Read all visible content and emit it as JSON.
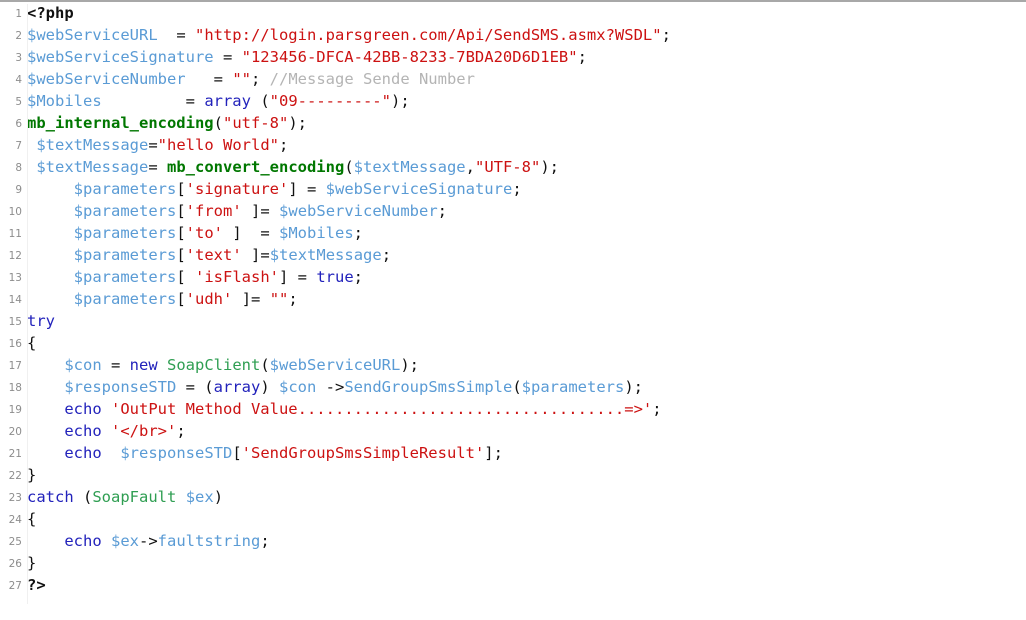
{
  "editor": {
    "language": "php",
    "total_lines": 27,
    "background": "#ffffff",
    "gutter_color": "#8d8d8d",
    "top_rule_color": "#a8a8a8"
  },
  "palette": {
    "variable": "#5a9bd5",
    "string": "#cc1111",
    "keyword": "#2222bb",
    "function": "#007700",
    "class": "#2f9e52",
    "comment": "#b4b4b4",
    "punctuation": "#111111"
  },
  "lines": [
    {
      "n": "1",
      "tokens": [
        {
          "t": "php",
          "v": "<?php"
        }
      ]
    },
    {
      "n": "2",
      "tokens": [
        {
          "t": "var",
          "v": "$webServiceURL"
        },
        {
          "t": "plain",
          "v": "  = "
        },
        {
          "t": "str",
          "v": "\"http://login.parsgreen.com/Api/SendSMS.asmx?WSDL\""
        },
        {
          "t": "punc",
          "v": ";"
        }
      ]
    },
    {
      "n": "3",
      "tokens": [
        {
          "t": "var",
          "v": "$webServiceSignature"
        },
        {
          "t": "plain",
          "v": " = "
        },
        {
          "t": "str",
          "v": "\"123456-DFCA-42BB-8233-7BDA20D6D1EB\""
        },
        {
          "t": "punc",
          "v": ";"
        }
      ]
    },
    {
      "n": "4",
      "tokens": [
        {
          "t": "var",
          "v": "$webServiceNumber"
        },
        {
          "t": "plain",
          "v": "   = "
        },
        {
          "t": "str",
          "v": "\"\""
        },
        {
          "t": "punc",
          "v": ";"
        },
        {
          "t": "plain",
          "v": " "
        },
        {
          "t": "com",
          "v": "//Message Sende Number"
        }
      ]
    },
    {
      "n": "5",
      "tokens": [
        {
          "t": "var",
          "v": "$Mobiles"
        },
        {
          "t": "plain",
          "v": "         = "
        },
        {
          "t": "kw",
          "v": "array"
        },
        {
          "t": "plain",
          "v": " ("
        },
        {
          "t": "str",
          "v": "\"09---------\""
        },
        {
          "t": "punc",
          "v": ");"
        }
      ]
    },
    {
      "n": "6",
      "tokens": [
        {
          "t": "fn",
          "v": "mb_internal_encoding"
        },
        {
          "t": "punc",
          "v": "("
        },
        {
          "t": "str",
          "v": "\"utf-8\""
        },
        {
          "t": "punc",
          "v": ");"
        }
      ]
    },
    {
      "n": "7",
      "tokens": [
        {
          "t": "plain",
          "v": " "
        },
        {
          "t": "var",
          "v": "$textMessage"
        },
        {
          "t": "plain",
          "v": "="
        },
        {
          "t": "str",
          "v": "\"hello World\""
        },
        {
          "t": "punc",
          "v": ";"
        }
      ]
    },
    {
      "n": "8",
      "tokens": [
        {
          "t": "plain",
          "v": " "
        },
        {
          "t": "var",
          "v": "$textMessage"
        },
        {
          "t": "plain",
          "v": "= "
        },
        {
          "t": "fn",
          "v": "mb_convert_encoding"
        },
        {
          "t": "punc",
          "v": "("
        },
        {
          "t": "var",
          "v": "$textMessage"
        },
        {
          "t": "punc",
          "v": ","
        },
        {
          "t": "str",
          "v": "\"UTF-8\""
        },
        {
          "t": "punc",
          "v": ");"
        }
      ]
    },
    {
      "n": "9",
      "tokens": [
        {
          "t": "plain",
          "v": "     "
        },
        {
          "t": "var",
          "v": "$parameters"
        },
        {
          "t": "punc",
          "v": "["
        },
        {
          "t": "str",
          "v": "'signature'"
        },
        {
          "t": "punc",
          "v": "]"
        },
        {
          "t": "plain",
          "v": " = "
        },
        {
          "t": "var",
          "v": "$webServiceSignature"
        },
        {
          "t": "punc",
          "v": ";"
        }
      ]
    },
    {
      "n": "10",
      "tokens": [
        {
          "t": "plain",
          "v": "     "
        },
        {
          "t": "var",
          "v": "$parameters"
        },
        {
          "t": "punc",
          "v": "["
        },
        {
          "t": "str",
          "v": "'from'"
        },
        {
          "t": "plain",
          "v": " "
        },
        {
          "t": "punc",
          "v": "]"
        },
        {
          "t": "plain",
          "v": "= "
        },
        {
          "t": "var",
          "v": "$webServiceNumber"
        },
        {
          "t": "punc",
          "v": ";"
        }
      ]
    },
    {
      "n": "11",
      "tokens": [
        {
          "t": "plain",
          "v": "     "
        },
        {
          "t": "var",
          "v": "$parameters"
        },
        {
          "t": "punc",
          "v": "["
        },
        {
          "t": "str",
          "v": "'to'"
        },
        {
          "t": "plain",
          "v": " "
        },
        {
          "t": "punc",
          "v": "]"
        },
        {
          "t": "plain",
          "v": "  = "
        },
        {
          "t": "var",
          "v": "$Mobiles"
        },
        {
          "t": "punc",
          "v": ";"
        }
      ]
    },
    {
      "n": "12",
      "tokens": [
        {
          "t": "plain",
          "v": "     "
        },
        {
          "t": "var",
          "v": "$parameters"
        },
        {
          "t": "punc",
          "v": "["
        },
        {
          "t": "str",
          "v": "'text'"
        },
        {
          "t": "plain",
          "v": " "
        },
        {
          "t": "punc",
          "v": "]"
        },
        {
          "t": "plain",
          "v": "="
        },
        {
          "t": "var",
          "v": "$textMessage"
        },
        {
          "t": "punc",
          "v": ";"
        }
      ]
    },
    {
      "n": "13",
      "tokens": [
        {
          "t": "plain",
          "v": "     "
        },
        {
          "t": "var",
          "v": "$parameters"
        },
        {
          "t": "punc",
          "v": "[ "
        },
        {
          "t": "str",
          "v": "'isFlash'"
        },
        {
          "t": "punc",
          "v": "]"
        },
        {
          "t": "plain",
          "v": " = "
        },
        {
          "t": "kw",
          "v": "true"
        },
        {
          "t": "punc",
          "v": ";"
        }
      ]
    },
    {
      "n": "14",
      "tokens": [
        {
          "t": "plain",
          "v": "     "
        },
        {
          "t": "var",
          "v": "$parameters"
        },
        {
          "t": "punc",
          "v": "["
        },
        {
          "t": "str",
          "v": "'udh'"
        },
        {
          "t": "plain",
          "v": " "
        },
        {
          "t": "punc",
          "v": "]"
        },
        {
          "t": "plain",
          "v": "= "
        },
        {
          "t": "str",
          "v": "\"\""
        },
        {
          "t": "punc",
          "v": ";"
        }
      ]
    },
    {
      "n": "15",
      "tokens": [
        {
          "t": "kw",
          "v": "try"
        }
      ]
    },
    {
      "n": "16",
      "tokens": [
        {
          "t": "punc",
          "v": "{"
        }
      ]
    },
    {
      "n": "17",
      "tokens": [
        {
          "t": "plain",
          "v": "    "
        },
        {
          "t": "var",
          "v": "$con"
        },
        {
          "t": "plain",
          "v": " = "
        },
        {
          "t": "kw",
          "v": "new"
        },
        {
          "t": "plain",
          "v": " "
        },
        {
          "t": "cls",
          "v": "SoapClient"
        },
        {
          "t": "punc",
          "v": "("
        },
        {
          "t": "var",
          "v": "$webServiceURL"
        },
        {
          "t": "punc",
          "v": ");"
        }
      ]
    },
    {
      "n": "18",
      "tokens": [
        {
          "t": "plain",
          "v": "    "
        },
        {
          "t": "var",
          "v": "$responseSTD"
        },
        {
          "t": "plain",
          "v": " = ("
        },
        {
          "t": "kw",
          "v": "array"
        },
        {
          "t": "punc",
          "v": ")"
        },
        {
          "t": "plain",
          "v": " "
        },
        {
          "t": "var",
          "v": "$con"
        },
        {
          "t": "plain",
          "v": " "
        },
        {
          "t": "op",
          "v": "->"
        },
        {
          "t": "meth",
          "v": "SendGroupSmsSimple"
        },
        {
          "t": "punc",
          "v": "("
        },
        {
          "t": "var",
          "v": "$parameters"
        },
        {
          "t": "punc",
          "v": ");"
        }
      ]
    },
    {
      "n": "19",
      "tokens": [
        {
          "t": "plain",
          "v": "    "
        },
        {
          "t": "kw",
          "v": "echo"
        },
        {
          "t": "plain",
          "v": " "
        },
        {
          "t": "str",
          "v": "'OutPut Method Value...................................=>'"
        },
        {
          "t": "punc",
          "v": ";"
        }
      ]
    },
    {
      "n": "20",
      "tokens": [
        {
          "t": "plain",
          "v": "    "
        },
        {
          "t": "kw",
          "v": "echo"
        },
        {
          "t": "plain",
          "v": " "
        },
        {
          "t": "str",
          "v": "'</br>'"
        },
        {
          "t": "punc",
          "v": ";"
        }
      ]
    },
    {
      "n": "21",
      "tokens": [
        {
          "t": "plain",
          "v": "    "
        },
        {
          "t": "kw",
          "v": "echo"
        },
        {
          "t": "plain",
          "v": "  "
        },
        {
          "t": "var",
          "v": "$responseSTD"
        },
        {
          "t": "punc",
          "v": "["
        },
        {
          "t": "str",
          "v": "'SendGroupSmsSimpleResult'"
        },
        {
          "t": "punc",
          "v": "];"
        }
      ]
    },
    {
      "n": "22",
      "tokens": [
        {
          "t": "punc",
          "v": "}"
        }
      ]
    },
    {
      "n": "23",
      "tokens": [
        {
          "t": "kw",
          "v": "catch"
        },
        {
          "t": "plain",
          "v": " ("
        },
        {
          "t": "cls",
          "v": "SoapFault"
        },
        {
          "t": "plain",
          "v": " "
        },
        {
          "t": "var",
          "v": "$ex"
        },
        {
          "t": "punc",
          "v": ")"
        }
      ]
    },
    {
      "n": "24",
      "tokens": [
        {
          "t": "punc",
          "v": "{"
        }
      ]
    },
    {
      "n": "25",
      "tokens": [
        {
          "t": "plain",
          "v": "    "
        },
        {
          "t": "kw",
          "v": "echo"
        },
        {
          "t": "plain",
          "v": " "
        },
        {
          "t": "var",
          "v": "$ex"
        },
        {
          "t": "op",
          "v": "->"
        },
        {
          "t": "meth",
          "v": "faultstring"
        },
        {
          "t": "punc",
          "v": ";"
        }
      ]
    },
    {
      "n": "26",
      "tokens": [
        {
          "t": "punc",
          "v": "}"
        }
      ]
    },
    {
      "n": "27",
      "tokens": [
        {
          "t": "php",
          "v": "?>"
        }
      ]
    }
  ]
}
